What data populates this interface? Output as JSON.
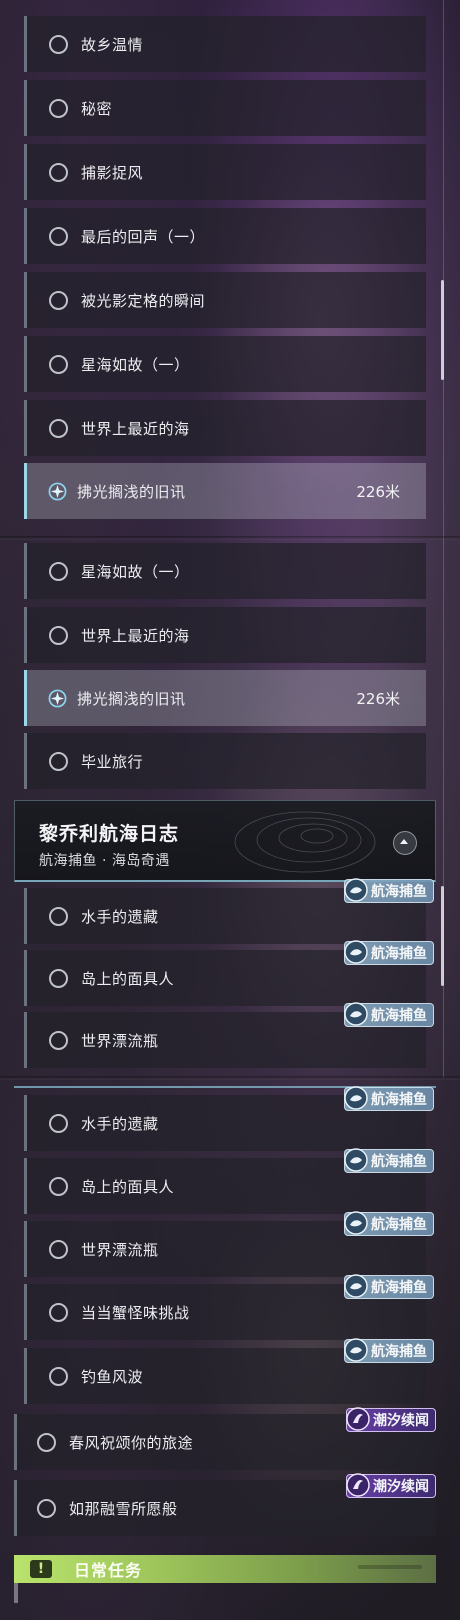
{
  "panel1": {
    "items": [
      {
        "label": "故乡温情"
      },
      {
        "label": "秘密"
      },
      {
        "label": "捕影捉风"
      },
      {
        "label": "最后的回声（一）"
      },
      {
        "label": "被光影定格的瞬间"
      },
      {
        "label": "星海如故（一）"
      },
      {
        "label": "世界上最近的海"
      },
      {
        "label": "拂光搁浅的旧讯",
        "distance": "226米",
        "tracking": true
      }
    ]
  },
  "panel2": {
    "items": [
      {
        "label": "星海如故（一）"
      },
      {
        "label": "世界上最近的海"
      },
      {
        "label": "拂光搁浅的旧讯",
        "distance": "226米",
        "tracking": true
      },
      {
        "label": "毕业旅行"
      }
    ],
    "journal": {
      "title": "黎乔利航海日志",
      "subtitle": "航海捕鱼 · 海岛奇遇"
    },
    "quests": [
      {
        "label": "水手的遗藏",
        "tag": "航海捕鱼"
      },
      {
        "label": "岛上的面具人",
        "tag": "航海捕鱼"
      },
      {
        "label": "世界漂流瓶",
        "tag": "航海捕鱼"
      }
    ]
  },
  "panel3": {
    "quests": [
      {
        "label": "水手的遗藏",
        "tag": "航海捕鱼"
      },
      {
        "label": "岛上的面具人",
        "tag": "航海捕鱼"
      },
      {
        "label": "世界漂流瓶",
        "tag": "航海捕鱼"
      },
      {
        "label": "当当蟹怪味挑战",
        "tag": "航海捕鱼"
      },
      {
        "label": "钓鱼风波",
        "tag": "航海捕鱼"
      },
      {
        "label": "春风祝颂你的旅途",
        "tag": "潮汐续闻"
      },
      {
        "label": "如那融雪所愿般",
        "tag": "潮汐续闻"
      }
    ],
    "daily": {
      "icon": "!",
      "label": "日常任务"
    }
  },
  "colors": {
    "accent_selected": "#9ad6ec",
    "tag_fishing": "#7fa3c0",
    "tag_tide": "#5a3596",
    "daily_green": "#b9e36c"
  },
  "icons": {
    "radio": "radio-circle-icon",
    "tracking": "navigation-target-icon",
    "fishing_tag": "fishing-tag-icon",
    "tide_tag": "tide-tag-icon",
    "collapse": "chevron-up-icon",
    "daily": "exclamation-icon"
  }
}
